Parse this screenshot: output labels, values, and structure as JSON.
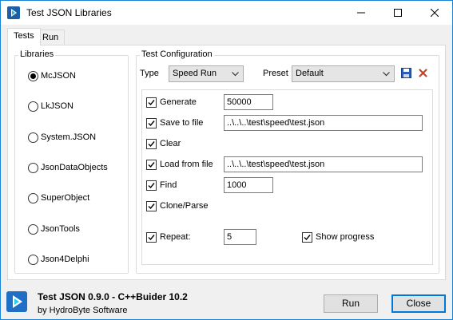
{
  "window": {
    "title": "Test JSON Libraries",
    "accent": "#1883d7"
  },
  "tabs": [
    {
      "label": "Tests",
      "active": true
    },
    {
      "label": "Run",
      "active": false
    }
  ],
  "libraries": {
    "caption": "Libraries",
    "items": [
      {
        "label": "McJSON",
        "checked": true
      },
      {
        "label": "LkJSON",
        "checked": false
      },
      {
        "label": "System.JSON",
        "checked": false
      },
      {
        "label": "JsonDataObjects",
        "checked": false
      },
      {
        "label": "SuperObject",
        "checked": false
      },
      {
        "label": "JsonTools",
        "checked": false
      },
      {
        "label": "Json4Delphi",
        "checked": false
      }
    ]
  },
  "config": {
    "caption": "Test Configuration",
    "type_label": "Type",
    "type_value": "Speed Run",
    "preset_label": "Preset",
    "preset_value": "Default",
    "save_icon": "save-icon",
    "delete_icon": "delete-icon",
    "options": {
      "generate": {
        "label": "Generate",
        "checked": true,
        "value": "50000"
      },
      "save_to_file": {
        "label": "Save to file",
        "checked": true,
        "value": "..\\..\\..\\test\\speed\\test.json"
      },
      "clear": {
        "label": "Clear",
        "checked": true
      },
      "load_from_file": {
        "label": "Load from file",
        "checked": true,
        "value": "..\\..\\..\\test\\speed\\test.json"
      },
      "find": {
        "label": "Find",
        "checked": true,
        "value": "1000"
      },
      "clone_parse": {
        "label": "Clone/Parse",
        "checked": true
      },
      "repeat": {
        "label": "Repeat:",
        "checked": true,
        "value": "5"
      },
      "show_progress": {
        "label": "Show progress",
        "checked": true
      }
    }
  },
  "footer": {
    "title": "Test JSON 0.9.0 - C++Buider 10.2",
    "subtitle": "by HydroByte Software",
    "run_label": "Run",
    "close_label": "Close"
  }
}
